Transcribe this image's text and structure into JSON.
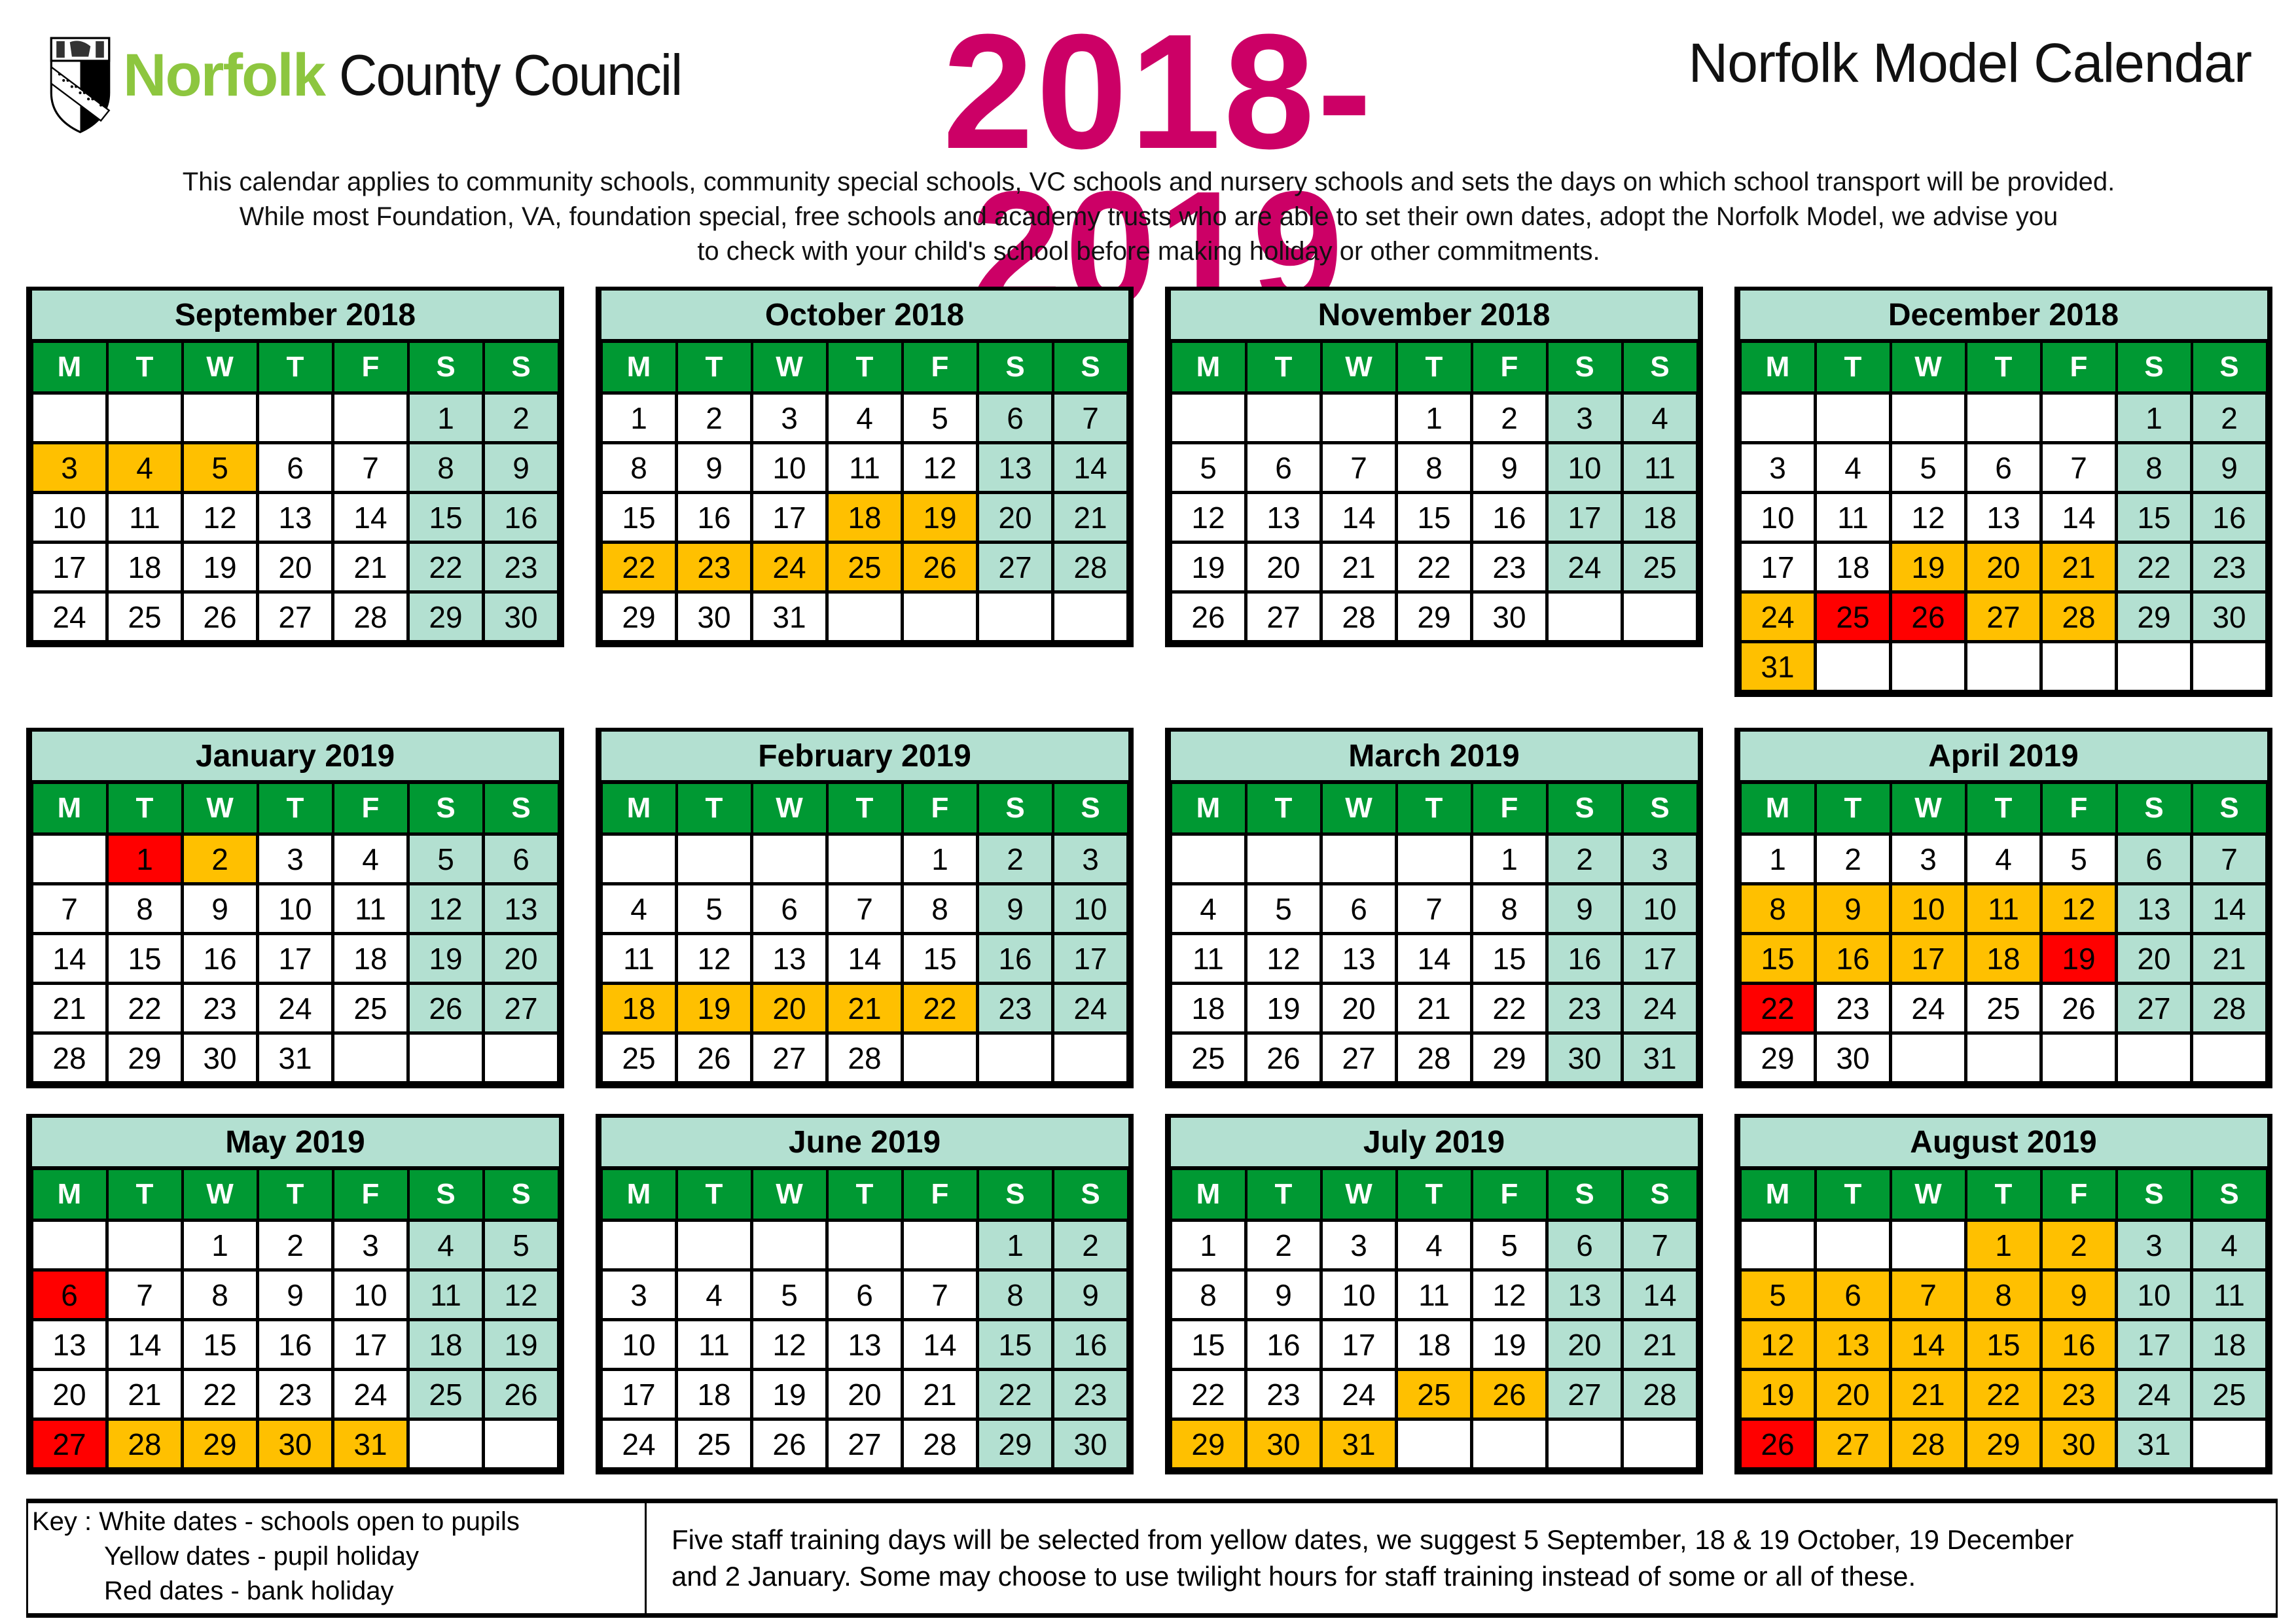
{
  "header": {
    "logo_name_green": "Norfolk",
    "logo_name_black": "County Council",
    "year_title": "2018-2019",
    "calendar_title": "Norfolk Model Calendar",
    "description_lines": [
      "This calendar applies to community schools, community special schools, VC schools and nursery schools and sets the days on which school transport will be provided.",
      "While most Foundation, VA, foundation special, free schools and academy trusts who are able to set their own dates, adopt the Norfolk Model, we advise you",
      "to check with your child's school before making holiday or other commitments."
    ]
  },
  "colors": {
    "title_pink": "#CC0066",
    "logo_green": "#8DC63F",
    "weekday_header_green": "#009933",
    "weekend_mint": "#B3E0D1",
    "pupil_holiday_yellow": "#FFC000",
    "bank_holiday_red": "#FF0000"
  },
  "weekday_labels": [
    "M",
    "T",
    "W",
    "T",
    "F",
    "S",
    "S"
  ],
  "months": [
    {
      "title": "September 2018",
      "offset": 5,
      "days": 30,
      "rows": 5,
      "holiday": [
        3,
        4,
        5
      ],
      "bank": []
    },
    {
      "title": "October 2018",
      "offset": 0,
      "days": 31,
      "rows": 5,
      "holiday": [
        18,
        19,
        22,
        23,
        24,
        25,
        26
      ],
      "bank": []
    },
    {
      "title": "November 2018",
      "offset": 3,
      "days": 30,
      "rows": 5,
      "holiday": [],
      "bank": []
    },
    {
      "title": "December 2018",
      "offset": 5,
      "days": 31,
      "rows": 6,
      "holiday": [
        19,
        20,
        21,
        24,
        27,
        28,
        31
      ],
      "bank": [
        25,
        26
      ]
    },
    {
      "title": "January 2019",
      "offset": 1,
      "days": 31,
      "rows": 5,
      "holiday": [
        2
      ],
      "bank": [
        1
      ]
    },
    {
      "title": "February 2019",
      "offset": 4,
      "days": 28,
      "rows": 5,
      "holiday": [
        18,
        19,
        20,
        21,
        22
      ],
      "bank": []
    },
    {
      "title": "March 2019",
      "offset": 4,
      "days": 31,
      "rows": 5,
      "holiday": [],
      "bank": []
    },
    {
      "title": "April 2019",
      "offset": 0,
      "days": 30,
      "rows": 5,
      "holiday": [
        8,
        9,
        10,
        11,
        12,
        15,
        16,
        17,
        18
      ],
      "bank": [
        19,
        22
      ]
    },
    {
      "title": "May 2019",
      "offset": 2,
      "days": 31,
      "rows": 5,
      "holiday": [
        28,
        29,
        30,
        31
      ],
      "bank": [
        6,
        27
      ]
    },
    {
      "title": "June 2019",
      "offset": 5,
      "days": 30,
      "rows": 5,
      "holiday": [],
      "bank": []
    },
    {
      "title": "July 2019",
      "offset": 0,
      "days": 31,
      "rows": 5,
      "holiday": [
        25,
        26,
        29,
        30,
        31
      ],
      "bank": []
    },
    {
      "title": "August 2019",
      "offset": 3,
      "days": 31,
      "rows": 5,
      "holiday": [
        1,
        2,
        5,
        6,
        7,
        8,
        9,
        12,
        13,
        14,
        15,
        16,
        19,
        20,
        21,
        22,
        23,
        27,
        28,
        29,
        30
      ],
      "bank": [
        26
      ]
    }
  ],
  "key": {
    "line1": "Key : White dates - schools open to pupils",
    "line2": "Yellow dates - pupil holiday",
    "line3": "Red dates - bank holiday",
    "note_line1": "Five staff training days will be selected from yellow dates, we suggest 5 September, 18 & 19 October, 19 December",
    "note_line2": "and 2 January.  Some may choose to use twilight hours for staff training instead of some or all of these."
  }
}
